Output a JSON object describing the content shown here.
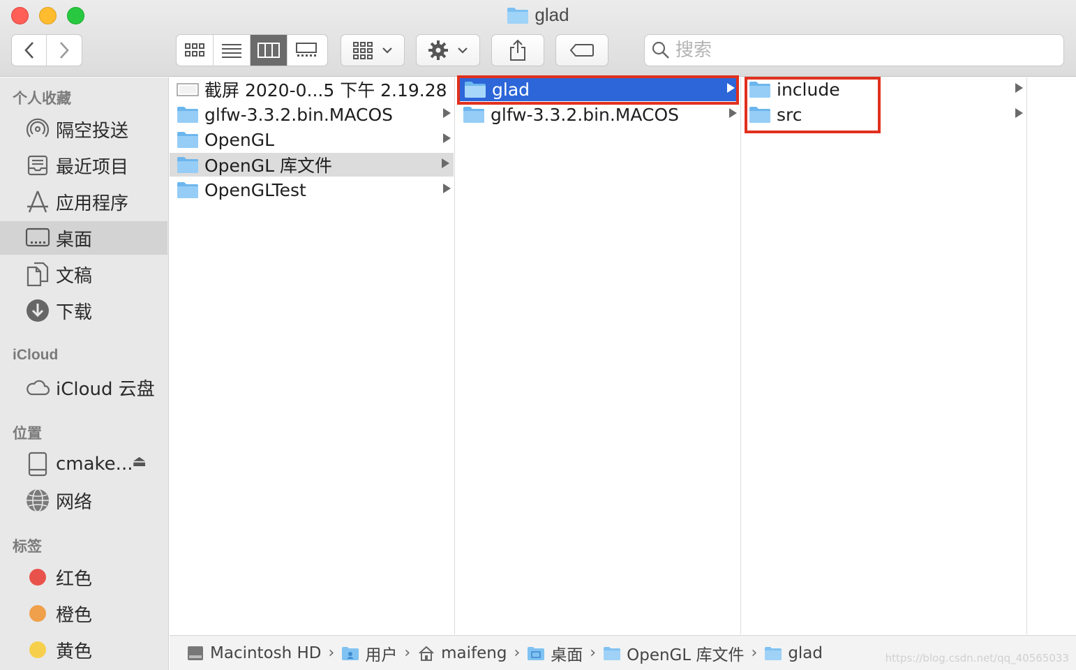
{
  "window": {
    "title": "glad"
  },
  "toolbar": {
    "back": "back-icon",
    "forward": "forward-icon",
    "views": [
      "icon-view",
      "list-view",
      "column-view",
      "gallery-view"
    ],
    "active_view": "column-view",
    "search_placeholder": "搜索"
  },
  "sidebar": {
    "favorites_header": "个人收藏",
    "favorites": [
      {
        "label": "隔空投送",
        "icon": "airdrop-icon"
      },
      {
        "label": "最近项目",
        "icon": "recents-icon"
      },
      {
        "label": "应用程序",
        "icon": "applications-icon"
      },
      {
        "label": "桌面",
        "icon": "desktop-icon",
        "selected": true
      },
      {
        "label": "文稿",
        "icon": "documents-icon"
      },
      {
        "label": "下载",
        "icon": "downloads-icon"
      }
    ],
    "icloud_header": "iCloud",
    "icloud": [
      {
        "label": "iCloud 云盘",
        "icon": "cloud-icon"
      }
    ],
    "locations_header": "位置",
    "locations": [
      {
        "label": "cmake...",
        "icon": "disk-icon"
      },
      {
        "label": "网络",
        "icon": "network-icon"
      }
    ],
    "tags_header": "标签",
    "tags": [
      {
        "label": "红色",
        "color": "#e9524a"
      },
      {
        "label": "橙色",
        "color": "#f0a04b"
      },
      {
        "label": "黄色",
        "color": "#f6d04d"
      }
    ]
  },
  "columns": [
    {
      "items": [
        {
          "name": "截屏 2020-0...5 下午 2.19.28",
          "type": "image",
          "arrow": false
        },
        {
          "name": "glfw-3.3.2.bin.MACOS",
          "type": "folder",
          "arrow": true
        },
        {
          "name": "OpenGL",
          "type": "folder",
          "arrow": true
        },
        {
          "name": "OpenGL 库文件",
          "type": "folder",
          "arrow": true,
          "highlight": "gray"
        },
        {
          "name": "OpenGLTest",
          "type": "folder",
          "arrow": true
        }
      ]
    },
    {
      "items": [
        {
          "name": "glad",
          "type": "folder",
          "arrow": true,
          "highlight": "blue"
        },
        {
          "name": "glfw-3.3.2.bin.MACOS",
          "type": "folder",
          "arrow": true
        }
      ]
    },
    {
      "items": [
        {
          "name": "include",
          "type": "folder",
          "arrow": true
        },
        {
          "name": "src",
          "type": "folder",
          "arrow": true
        }
      ]
    }
  ],
  "pathbar": [
    {
      "label": "Macintosh HD",
      "icon": "harddisk-icon"
    },
    {
      "label": "用户",
      "icon": "users-folder-icon"
    },
    {
      "label": "maifeng",
      "icon": "home-icon"
    },
    {
      "label": "桌面",
      "icon": "desktop-folder-icon"
    },
    {
      "label": "OpenGL 库文件",
      "icon": "folder-icon"
    },
    {
      "label": "glad",
      "icon": "folder-icon"
    }
  ],
  "watermark": "https://blog.csdn.net/qq_40565033"
}
